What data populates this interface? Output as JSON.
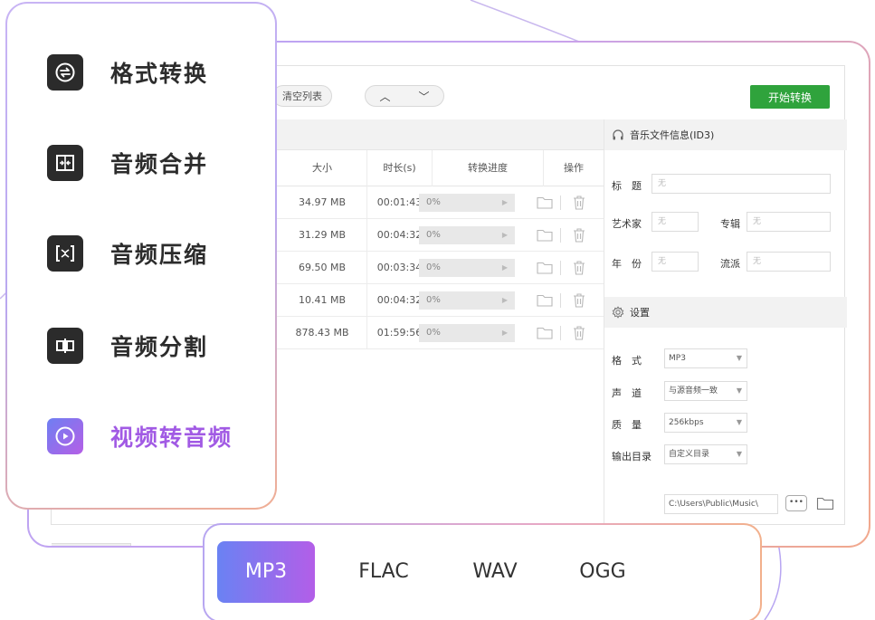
{
  "features": [
    {
      "label": "格式转换",
      "icon": "format-convert-icon",
      "active": false
    },
    {
      "label": "音频合并",
      "icon": "audio-merge-icon",
      "active": false
    },
    {
      "label": "音频压缩",
      "icon": "audio-compress-icon",
      "active": false
    },
    {
      "label": "音频分割",
      "icon": "audio-split-icon",
      "active": false
    },
    {
      "label": "视频转音频",
      "icon": "video-to-audio-icon",
      "active": true
    }
  ],
  "toolbar": {
    "clear_list": "清空列表",
    "move_up": "︿",
    "move_down": "﹀",
    "start_convert": "开始转换"
  },
  "table": {
    "headers": {
      "size": "大小",
      "duration": "时长(s)",
      "progress": "转换进度",
      "actions": "操作"
    },
    "rows": [
      {
        "size": "34.97 MB",
        "duration": "00:01:43",
        "progress": "0%"
      },
      {
        "size": "31.29 MB",
        "duration": "00:04:32",
        "progress": "0%"
      },
      {
        "size": "69.50 MB",
        "duration": "00:03:34",
        "progress": "0%"
      },
      {
        "size": "10.41 MB",
        "duration": "00:04:32",
        "progress": "0%"
      },
      {
        "size": "878.43 MB",
        "duration": "01:59:56",
        "progress": "0%"
      }
    ]
  },
  "info_panel": {
    "title": "音乐文件信息(ID3)",
    "title_label": "标　题",
    "title_value": "无",
    "artist_label": "艺术家",
    "artist_value": "无",
    "album_label": "专辑",
    "album_value": "无",
    "year_label": "年　份",
    "year_value": "无",
    "genre_label": "流派",
    "genre_value": "无"
  },
  "settings": {
    "title": "设置",
    "format_label": "格　式",
    "format_value": "MP3",
    "channel_label": "声　道",
    "channel_value": "与源音频一致",
    "quality_label": "质　量",
    "quality_value": "256kbps",
    "output_label": "输出目录",
    "output_value": "自定义目录",
    "path_value": "C:\\Users\\Public\\Music\\",
    "browse_label": "•••"
  },
  "formats": [
    {
      "label": "MP3",
      "active": true
    },
    {
      "label": "FLAC",
      "active": false
    },
    {
      "label": "WAV",
      "active": false
    },
    {
      "label": "OGG",
      "active": false
    }
  ],
  "colors": {
    "accent_gradient_start": "#6a82f3",
    "accent_gradient_end": "#b35ee8",
    "active_text": "#a15ae4",
    "start_button": "#2fa33c"
  }
}
